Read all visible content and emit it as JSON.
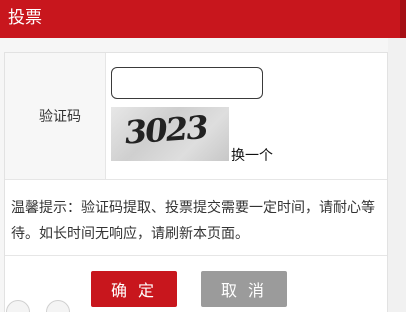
{
  "header": {
    "title": "投票",
    "bg_color": "#c8161d"
  },
  "form": {
    "captcha_label": "验证码",
    "captcha_input_value": "",
    "captcha_image_text": "3023",
    "refresh_link": "换一个"
  },
  "tip": {
    "text": "温馨提示：验证码提取、投票提交需要一定时间，请耐心等待。如长时间无响应，请刷新本页面。"
  },
  "buttons": {
    "confirm_label": "确 定",
    "cancel_label": "取 消",
    "confirm_color": "#c8161d",
    "cancel_color": "#9b9b9b"
  }
}
